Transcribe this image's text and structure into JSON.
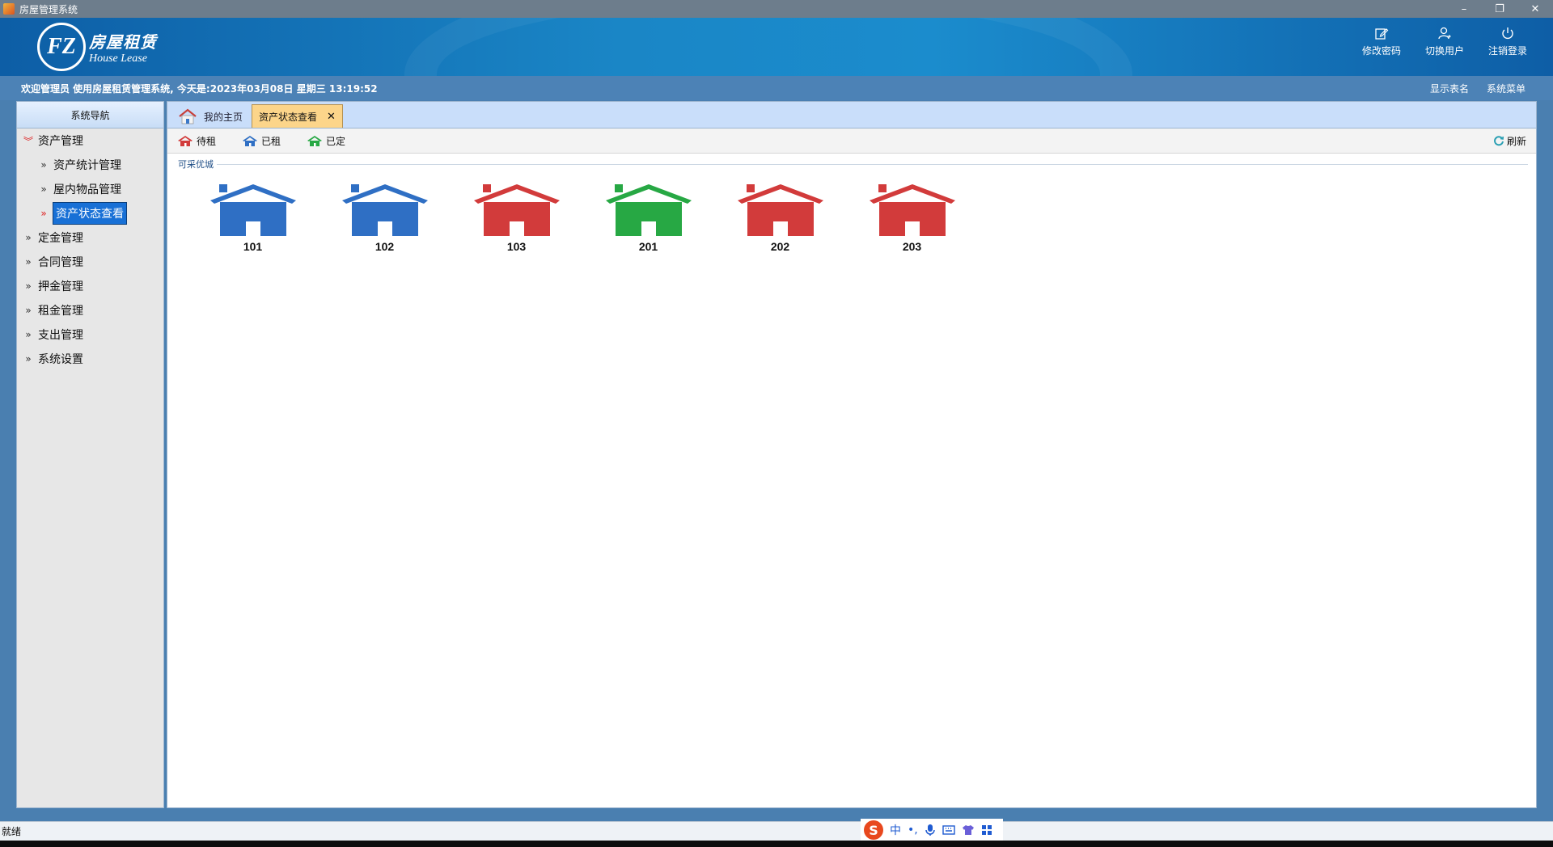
{
  "window": {
    "title": "房屋管理系统",
    "controls": [
      "–",
      "❐",
      "✕"
    ]
  },
  "header": {
    "logo_mark": "FZ",
    "logo_cn": "房屋租赁",
    "logo_en": "House Lease",
    "actions": [
      {
        "label": "修改密码",
        "icon": "edit-icon"
      },
      {
        "label": "切换用户",
        "icon": "user-switch-icon"
      },
      {
        "label": "注销登录",
        "icon": "power-icon"
      }
    ]
  },
  "welcome": {
    "text": "欢迎管理员 使用房屋租赁管理系统, 今天是:2023年03月08日 星期三 13:19:52",
    "links": [
      "显示表名",
      "系统菜单"
    ]
  },
  "sidebar": {
    "title": "系统导航",
    "items": [
      {
        "label": "资产管理",
        "open": true
      },
      {
        "label": "资产统计管理",
        "sub": true
      },
      {
        "label": "屋内物品管理",
        "sub": true
      },
      {
        "label": "资产状态查看",
        "sub": true,
        "active": true
      },
      {
        "label": "定金管理"
      },
      {
        "label": "合同管理"
      },
      {
        "label": "押金管理"
      },
      {
        "label": "租金管理"
      },
      {
        "label": "支出管理"
      },
      {
        "label": "系统设置"
      }
    ]
  },
  "tabs": [
    {
      "label": "我的主页"
    },
    {
      "label": "资产状态查看",
      "close": "✕"
    }
  ],
  "toolbar": {
    "legend": [
      {
        "label": "待租",
        "color": "#d23b3b"
      },
      {
        "label": "已租",
        "color": "#2f6fc4"
      },
      {
        "label": "已定",
        "color": "#27a844"
      }
    ],
    "refresh": "刷新"
  },
  "group": {
    "label": "可采优城",
    "houses": [
      {
        "number": "101",
        "status": "已租",
        "color": "#2f6fc4"
      },
      {
        "number": "102",
        "status": "已租",
        "color": "#2f6fc4"
      },
      {
        "number": "103",
        "status": "待租",
        "color": "#d23b3b"
      },
      {
        "number": "201",
        "status": "已定",
        "color": "#27a844"
      },
      {
        "number": "202",
        "status": "待租",
        "color": "#d23b3b"
      },
      {
        "number": "203",
        "status": "待租",
        "color": "#d23b3b"
      }
    ]
  },
  "statusbar": {
    "text": "就绪"
  },
  "ime": {
    "logo": "S",
    "mode": "中",
    "punct": "•,"
  }
}
